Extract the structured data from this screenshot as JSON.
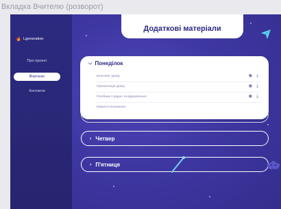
{
  "frame_title": "Вкладка Вчителю (розворот)",
  "brand": {
    "logo_text": "Lgeneration"
  },
  "sidebar": {
    "items": [
      {
        "label": "Про проект",
        "active": false
      },
      {
        "label": "Вчителю",
        "active": true
      },
      {
        "label": "Контакти",
        "active": false
      }
    ]
  },
  "header": {
    "title": "Додаткові матеріали"
  },
  "accordion_open": {
    "title": "Понеділок",
    "rows": [
      {
        "label": "Конспект уроку",
        "icons": [
          "eye-icon",
          "download-icon"
        ]
      },
      {
        "label": "Презентація уроку",
        "icons": [
          "eye-icon",
          "download-icon"
        ]
      },
      {
        "label": "Посібник з водно та відновлення",
        "icons": [
          "eye-icon",
          "download-icon"
        ]
      },
      {
        "label": "Корисні посилання",
        "icons": []
      }
    ]
  },
  "accordion_closed": [
    {
      "title": "Четвер"
    },
    {
      "title": "П'ятниця"
    }
  ],
  "colors": {
    "sidebar_bg": "#2c2a80",
    "main_bg": "#3e37a2",
    "accent": "#2c2a80",
    "flame": "#f05a28"
  }
}
